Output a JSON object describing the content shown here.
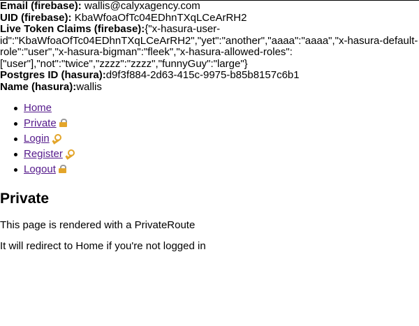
{
  "user_info": {
    "email_label": "Email (firebase):",
    "email_value": " wallis@calyxagency.com",
    "uid_label": "UID (firebase):",
    "uid_value": " KbaWfoaOfTc04EDhnTXqLCeArRH2",
    "claims_label": "Live Token Claims (firebase):",
    "claims_value": "{\"x-hasura-user-id\":\"KbaWfoaOfTc04EDhnTXqLCeArRH2\",\"yet\":\"another\",\"aaaa\":\"aaaa\",\"x-hasura-default-role\":\"user\",\"x-hasura-bigman\":\"fleek\",\"x-hasura-allowed-roles\": [\"user\"],\"not\":\"twice\",\"zzzz\":\"zzzz\",\"funnyGuy\":\"large\"}",
    "postgres_label": "Postgres ID (hasura):",
    "postgres_value": "d9f3f884-2d63-415c-9975-b85b8157c6b1",
    "name_label": "Name (hasura):",
    "name_value": "wallis"
  },
  "nav": {
    "items": [
      {
        "label": "Home",
        "icon": ""
      },
      {
        "label": "Private",
        "icon": "lock-icon"
      },
      {
        "label": "Login",
        "icon": "key-icon"
      },
      {
        "label": "Register",
        "icon": "key-icon"
      },
      {
        "label": "Logout",
        "icon": "lock-icon"
      }
    ]
  },
  "main": {
    "heading": "Private",
    "paragraph_1": "This page is rendered with a PrivateRoute",
    "paragraph_2": "It will redirect to Home if you're not logged in"
  },
  "colors": {
    "link": "#551a8b",
    "text": "#000000",
    "background": "#ffffff",
    "emoji_gold": "#e3a52a"
  }
}
